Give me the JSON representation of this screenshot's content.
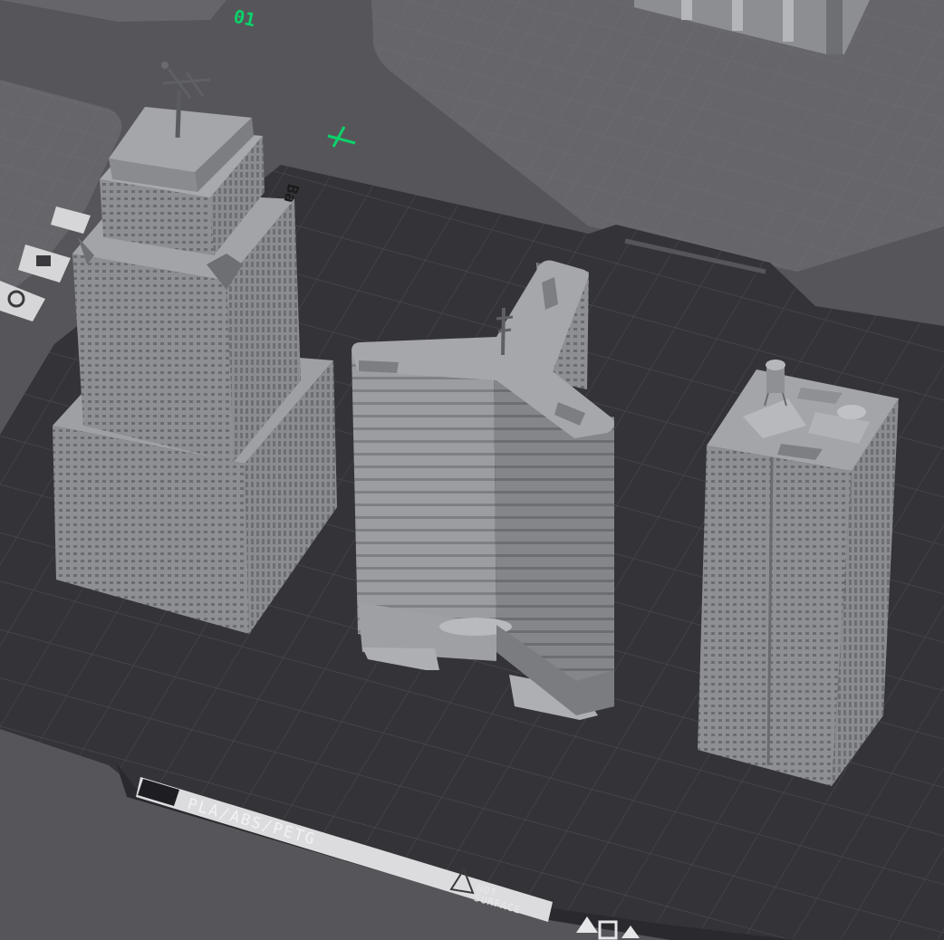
{
  "viewport": {
    "name": "3D build plate preview",
    "plate_number": "01",
    "brand_mark": "Ba",
    "filament_label": "PLA/ABS/PETG",
    "warning_label": "HOT\nSURFACE",
    "objects": [
      "stepped-skyscraper",
      "y-shaped-tower",
      "rectangular-tower-with-water-tank"
    ]
  },
  "colors": {
    "background": "#56565a",
    "plate": "#343438",
    "grid": "#5a5a5f",
    "model": "#8f9094",
    "accent": "#0bd36a"
  }
}
